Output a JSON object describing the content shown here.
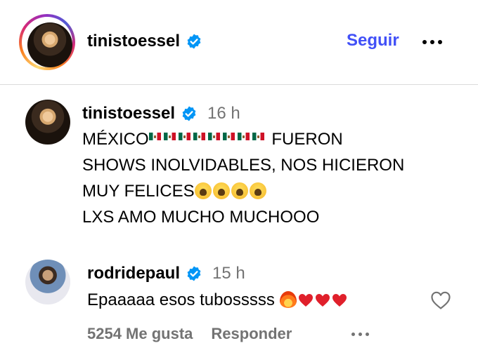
{
  "header": {
    "username": "tinistoessel",
    "follow_label": "Seguir"
  },
  "post": {
    "username": "tinistoessel",
    "time": "16 h",
    "caption_lines": {
      "line1_prefix": "MÉXICO",
      "line1_suffix": " FUERON",
      "line2": "SHOWS INOLVIDABLES, NOS HICIERON",
      "line3": "MUY FELICES",
      "line4": "LXS AMO MUCHO MUCHOOO"
    },
    "flag_count": 8,
    "cry_emoji_count": 4
  },
  "comment": {
    "username": "rodridepaul",
    "time": "15 h",
    "text": "Epaaaaa esos tubosssss ",
    "likes_label": "5254 Me gusta",
    "reply_label": "Responder"
  },
  "icons": {
    "verified": "verified-badge-icon",
    "more": "more-options-icon",
    "like": "heart-outline-icon",
    "flag": "mexico-flag-icon",
    "cry": "loudly-crying-face-icon",
    "fire": "fire-icon",
    "heart": "red-heart-icon"
  },
  "colors": {
    "accent": "#4150f7",
    "verified": "#0095f6",
    "secondary_text": "#737373",
    "divider": "#dbdbdb",
    "heart_red": "#e0202b"
  }
}
